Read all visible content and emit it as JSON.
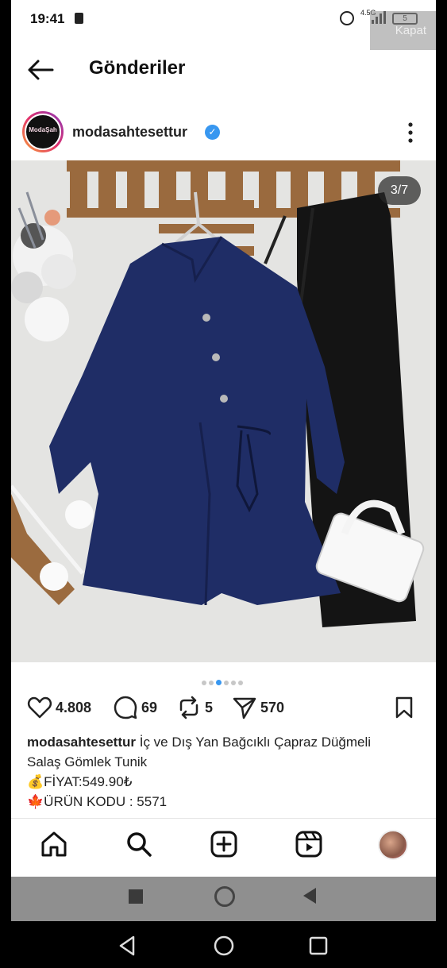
{
  "status_bar": {
    "time": "19:41",
    "network": "4.5G",
    "battery": "5",
    "overlay_button": "Kapat"
  },
  "header": {
    "title": "Gönderiler",
    "back_icon": "arrow-left-icon"
  },
  "post": {
    "username": "modasahtesettur",
    "avatar_text": "ModaŞah",
    "verified": true,
    "image_counter": "3/7",
    "carousel": {
      "total_dots": 6,
      "active_index": 2
    },
    "likes": "4.808",
    "comments": "69",
    "reposts": "5",
    "shares": "570",
    "caption": {
      "username": "modasahtesettur",
      "text_line1": "İç ve Dış Yan Bağcıklı Çapraz Düğmeli",
      "text_line2": "Salaş Gömlek Tunik",
      "price_line": "💰FİYAT:549.90₺",
      "code_line": "🍁ÜRÜN KODU : 5571"
    }
  },
  "bottom_nav": [
    "home-icon",
    "search-icon",
    "add-post-icon",
    "reels-icon",
    "profile-avatar"
  ],
  "colors": {
    "verified": "#3897f0",
    "text": "#222222",
    "tunic": "#1f2d66",
    "pants": "#141414"
  }
}
